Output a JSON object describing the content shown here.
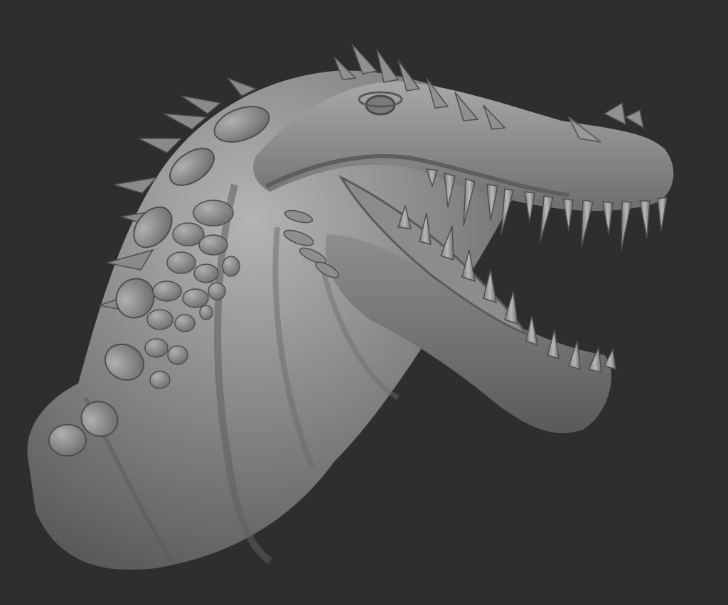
{
  "viewport": {
    "background_color": "#2e2e2e"
  },
  "model": {
    "material_light": "#a6a6a6",
    "material_mid": "#7a7a7a",
    "material_dark": "#4a4a4a",
    "material_shadow": "#3a3a3a"
  }
}
